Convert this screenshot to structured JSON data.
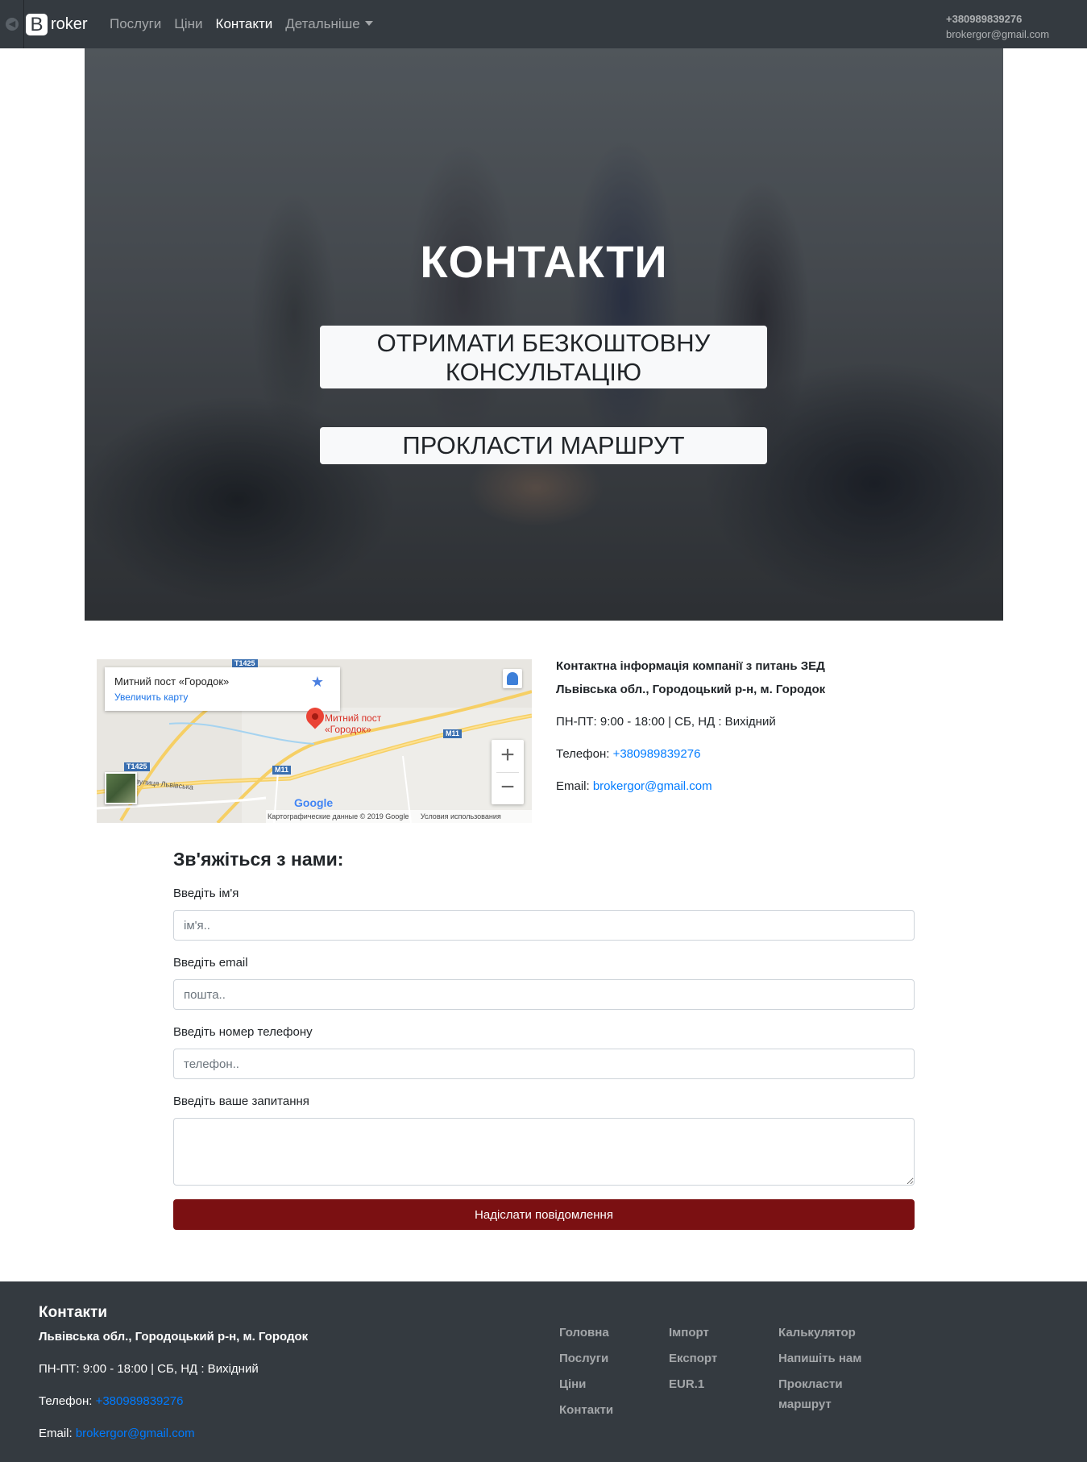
{
  "nav": {
    "brand_letter": "B",
    "brand_rest": "roker",
    "links": [
      "Послуги",
      "Ціни",
      "Контакти",
      "Детальніше"
    ],
    "phone": "+380989839276",
    "email": "brokergor@gmail.com"
  },
  "hero": {
    "title": "КОНТАКТИ",
    "btn_consult_line1": "ОТРИМАТИ БЕЗКОШТОВНУ",
    "btn_consult_line2": "КОНСУЛЬТАЦІЮ",
    "btn_route": "ПРОКЛАСТИ МАРШРУТ"
  },
  "map": {
    "place": "Митний пост «Городок»",
    "enlarge": "Увеличить карту",
    "pin_line1": "Митний пост",
    "pin_line2": "«Городок»",
    "logo": "Google",
    "data_credit": "Картографические данные © 2019 Google",
    "terms": "Условия использования",
    "road_t1425": "T1425",
    "road_m11": "M11",
    "street": "вулиця Львівська",
    "zoom_in": "+",
    "zoom_out": "−"
  },
  "contact": {
    "heading": "Контактна інформація компанії з питань ЗЕД",
    "address": "Львівська обл., Городоцький р-н, м. Городок",
    "hours": "ПН-ПТ: 9:00 - 18:00 | СБ, НД : Вихідний",
    "phone_label": "Телефон: ",
    "phone": "+380989839276",
    "email_label": "Email: ",
    "email": "brokergor@gmail.com"
  },
  "form": {
    "title": "Зв'яжіться з нами:",
    "name_label": "Введіть ім'я",
    "name_placeholder": "ім'я..",
    "email_label": "Введіть email",
    "email_placeholder": "пошта..",
    "phone_label": "Введіть номер телефону",
    "phone_placeholder": "телефон..",
    "question_label": "Введіть ваше запитання",
    "submit": "Надіслати повідомлення"
  },
  "footer": {
    "title": "Контакти",
    "address": "Львівська обл., Городоцький р-н, м. Городок",
    "hours": "ПН-ПТ: 9:00 - 18:00 | СБ, НД : Вихідний",
    "phone_label": "Телефон: ",
    "phone": "+380989839276",
    "email_label": "Email: ",
    "email": "brokergor@gmail.com",
    "col1": [
      "Головна",
      "Послуги",
      "Ціни",
      "Контакти"
    ],
    "col2": [
      "Імпорт",
      "Експорт",
      "EUR.1"
    ],
    "col3": [
      "Калькулятор",
      "Напишіть нам",
      "Прокласти маршрут"
    ]
  }
}
